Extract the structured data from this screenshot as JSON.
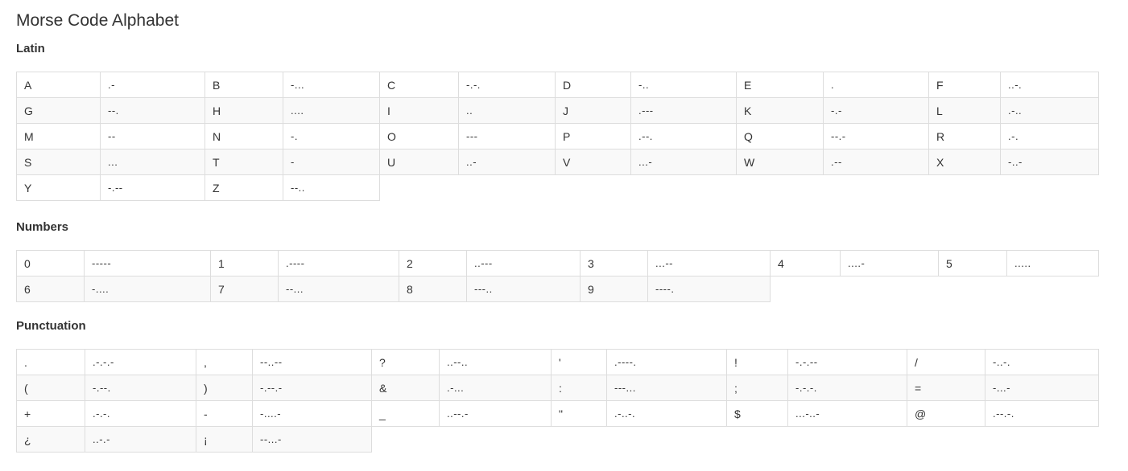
{
  "title": "Morse Code Alphabet",
  "sections": {
    "latin": {
      "heading": "Latin",
      "rows": [
        [
          [
            "A",
            ".-"
          ],
          [
            "B",
            "-..."
          ],
          [
            "C",
            "-.-."
          ],
          [
            "D",
            "-.."
          ],
          [
            "E",
            "."
          ],
          [
            "F",
            "..-."
          ]
        ],
        [
          [
            "G",
            "--."
          ],
          [
            "H",
            "...."
          ],
          [
            "I",
            ".."
          ],
          [
            "J",
            ".---"
          ],
          [
            "K",
            "-.-"
          ],
          [
            "L",
            ".-.."
          ]
        ],
        [
          [
            "M",
            "--"
          ],
          [
            "N",
            "-."
          ],
          [
            "O",
            "---"
          ],
          [
            "P",
            ".--."
          ],
          [
            "Q",
            "--.-"
          ],
          [
            "R",
            ".-."
          ]
        ],
        [
          [
            "S",
            "..."
          ],
          [
            "T",
            "-"
          ],
          [
            "U",
            "..-"
          ],
          [
            "V",
            "...-"
          ],
          [
            "W",
            ".--"
          ],
          [
            "X",
            "-..-"
          ]
        ],
        [
          [
            "Y",
            "-.--"
          ],
          [
            "Z",
            "--.."
          ]
        ]
      ]
    },
    "numbers": {
      "heading": "Numbers",
      "rows": [
        [
          [
            "0",
            "-----"
          ],
          [
            "1",
            ".----"
          ],
          [
            "2",
            "..---"
          ],
          [
            "3",
            "...--"
          ],
          [
            "4",
            "....-"
          ],
          [
            "5",
            "....."
          ]
        ],
        [
          [
            "6",
            "-...."
          ],
          [
            "7",
            "--..."
          ],
          [
            "8",
            "---.."
          ],
          [
            "9",
            "----."
          ]
        ]
      ]
    },
    "punctuation": {
      "heading": "Punctuation",
      "rows": [
        [
          [
            ".",
            ".-.-.-"
          ],
          [
            ",",
            "--..--"
          ],
          [
            "?",
            "..--.."
          ],
          [
            "'",
            ".----."
          ],
          [
            "!",
            "-.-.--"
          ],
          [
            "/",
            "-..-."
          ]
        ],
        [
          [
            "(",
            "-.--."
          ],
          [
            ")",
            "-.--.-"
          ],
          [
            "&",
            ".-..."
          ],
          [
            ":",
            "---..."
          ],
          [
            ";",
            "-.-.-."
          ],
          [
            "=",
            "-...-"
          ]
        ],
        [
          [
            "+",
            ".-.-."
          ],
          [
            "-",
            "-....-"
          ],
          [
            "_",
            "..--.-"
          ],
          [
            "\"",
            ".-..-."
          ],
          [
            "$",
            "...-..-"
          ],
          [
            "@",
            ".--.-."
          ]
        ],
        [
          [
            "¿",
            "..-.-"
          ],
          [
            "¡",
            "--...-"
          ]
        ]
      ]
    }
  }
}
